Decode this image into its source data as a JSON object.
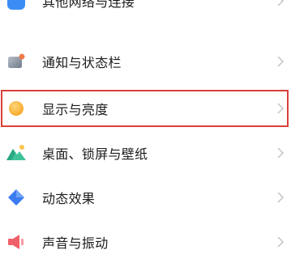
{
  "settings_list": {
    "items": [
      {
        "label": "其他网络与连接",
        "icon": "link-icon",
        "color": "#3b8df5"
      },
      {
        "label": "通知与状态栏",
        "icon": "notification-icon",
        "color": "#8e98a6",
        "dot_color": "#f07a4a"
      },
      {
        "label": "显示与亮度",
        "icon": "brightness-icon",
        "color": "#f6a623"
      },
      {
        "label": "桌面、锁屏与壁纸",
        "icon": "wallpaper-icon",
        "color": "#3fc29a"
      },
      {
        "label": "动态效果",
        "icon": "animation-icon",
        "color": "#3b7cf0"
      },
      {
        "label": "声音与振动",
        "icon": "sound-icon",
        "color": "#f0606a"
      }
    ]
  },
  "highlight_color": "#d9403a"
}
